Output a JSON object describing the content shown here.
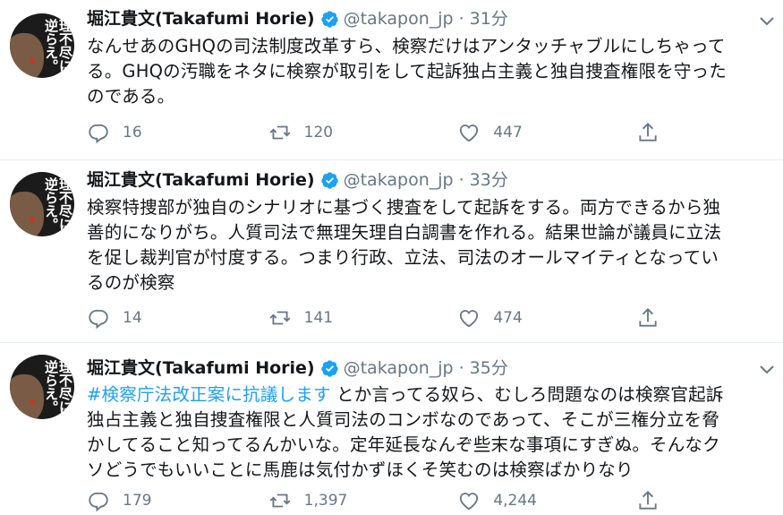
{
  "colors": {
    "link": "#1da1f2",
    "muted": "#657786",
    "text": "#14171a",
    "verified": "#1da1f2"
  },
  "avatar": {
    "logo_text": "理不尽に逆らえ。"
  },
  "tweets": [
    {
      "author": {
        "name": "堀江貴文(Takafumi Horie)",
        "handle": "@takapon_jp",
        "sep": "·",
        "time": "31分"
      },
      "text_lines": [
        "なんせあのGHQの司法制度改革すら、検察だけはアンタッチャブルにしちゃって",
        "る。GHQの汚職をネタに検察が取引をして起訴独占主義と独自捜査権限を守った",
        "のである。"
      ],
      "stats": {
        "replies": "16",
        "retweets": "120",
        "likes": "447"
      }
    },
    {
      "author": {
        "name": "堀江貴文(Takafumi Horie)",
        "handle": "@takapon_jp",
        "sep": "·",
        "time": "33分"
      },
      "text_lines": [
        "検察特捜部が独自のシナリオに基づく捜査をして起訴をする。両方できるから独",
        "善的になりがち。人質司法で無理矢理自白調書を作れる。結果世論が議員に立法",
        "を促し裁判官が忖度する。つまり行政、立法、司法のオールマイティとなってい",
        "るのが検察"
      ],
      "stats": {
        "replies": "14",
        "retweets": "141",
        "likes": "474"
      }
    },
    {
      "author": {
        "name": "堀江貴文(Takafumi Horie)",
        "handle": "@takapon_jp",
        "sep": "·",
        "time": "35分"
      },
      "hashtag": "#検察庁法改正案に抗議します",
      "first_line_rest": " とか言ってる奴ら、むしろ問題なのは検察官起訴",
      "text_lines": [
        "独占主義と独自捜査権限と人質司法のコンボなのであって、そこが三権分立を脅",
        "かしてること知ってるんかいな。定年延長なんぞ些末な事項にすぎぬ。そんなク",
        "ソどうでもいいことに馬鹿は気付かずほくそ笑むのは検察ばかりなり"
      ],
      "stats": {
        "replies": "179",
        "retweets": "1,397",
        "likes": "4,244"
      }
    }
  ],
  "icons": {
    "verified": "verified-badge-icon",
    "more": "chevron-down-icon",
    "reply": "reply-icon",
    "retweet": "retweet-icon",
    "like": "heart-icon",
    "share": "share-icon"
  }
}
